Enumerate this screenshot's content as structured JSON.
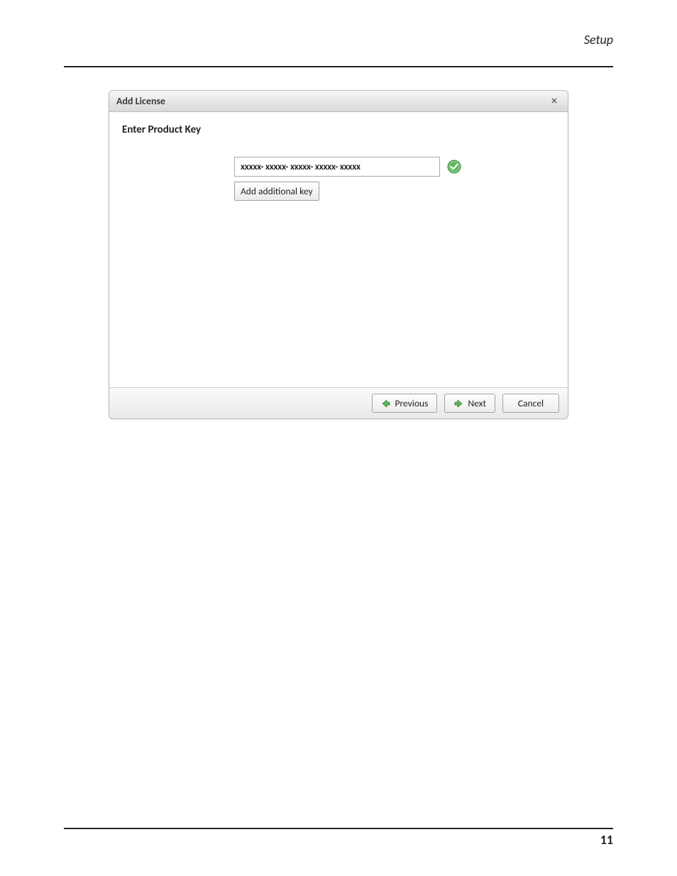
{
  "page": {
    "section_header": "Setup",
    "number": "11"
  },
  "dialog": {
    "title": "Add License",
    "section_title": "Enter Product Key",
    "product_key_value": "xxxxx- xxxxx- xxxxx- xxxxx- xxxxx",
    "add_key_label": "Add additional key",
    "buttons": {
      "previous": "Previous",
      "next": "Next",
      "cancel": "Cancel"
    }
  }
}
